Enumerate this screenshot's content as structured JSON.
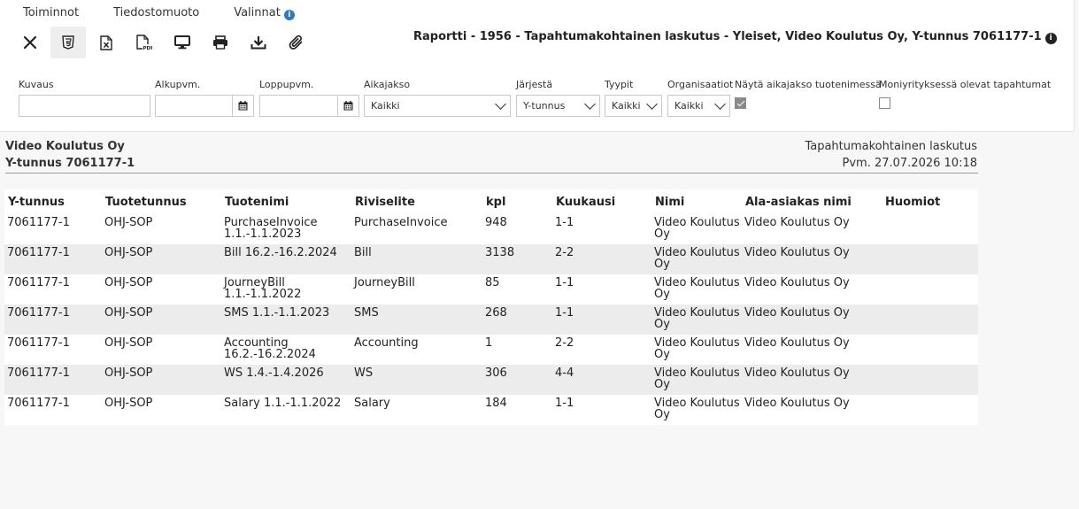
{
  "menu": {
    "actions": "Toiminnot",
    "file_format": "Tiedostomuoto",
    "options": "Valinnat",
    "info_glyph": "i"
  },
  "toolbar": {
    "icons": [
      "close-icon",
      "html5-icon",
      "excel-icon",
      "pdf-icon",
      "screen-icon",
      "print-icon",
      "download-icon",
      "attachment-icon"
    ]
  },
  "report_title": "Raportti - 1956 - Tapahtumakohtainen laskutus - Yleiset, Video Koulutus Oy, Y-tunnus 7061177-1",
  "filters": {
    "description": {
      "label": "Kuvaus",
      "value": ""
    },
    "start_date": {
      "label": "Alkupvm.",
      "value": ""
    },
    "end_date": {
      "label": "Loppupvm.",
      "value": ""
    },
    "period": {
      "label": "Aikajakso",
      "value": "Kaikki"
    },
    "sort": {
      "label": "Järjestä",
      "value": "Y-tunnus"
    },
    "types": {
      "label": "Tyypit",
      "value": "Kaikki"
    },
    "organisations": {
      "label": "Organisaatiot",
      "value": "Kaikki"
    },
    "show_period": {
      "label": "Näytä aikajakso tuotenimessä",
      "checked": true
    },
    "multi_company": {
      "label": "Moniyrityksessä olevat tapahtumat",
      "checked": false
    }
  },
  "company": {
    "name": "Video Koulutus Oy",
    "business_id": "Y-tunnus 7061177-1"
  },
  "meta": {
    "report_name": "Tapahtumakohtainen laskutus",
    "date": "Pvm. 27.07.2026 10:18"
  },
  "table": {
    "columns": [
      "Y-tunnus",
      "Tuotetunnus",
      "Tuotenimi",
      "Riviselite",
      "kpl",
      "Kuukausi",
      "Nimi",
      "Ala-asiakas nimi",
      "Huomiot"
    ],
    "rows": [
      [
        "7061177-1",
        "OHJ-SOP",
        "PurchaseInvoice 1.1.-1.1.2023",
        "PurchaseInvoice",
        "948",
        "1-1",
        "Video Koulutus Oy",
        "Video Koulutus Oy",
        ""
      ],
      [
        "7061177-1",
        "OHJ-SOP",
        "Bill 16.2.-16.2.2024",
        "Bill",
        "3138",
        "2-2",
        "Video Koulutus Oy",
        "Video Koulutus Oy",
        ""
      ],
      [
        "7061177-1",
        "OHJ-SOP",
        "JourneyBill 1.1.-1.1.2022",
        "JourneyBill",
        "85",
        "1-1",
        "Video Koulutus Oy",
        "Video Koulutus Oy",
        ""
      ],
      [
        "7061177-1",
        "OHJ-SOP",
        "SMS 1.1.-1.1.2023",
        "SMS",
        "268",
        "1-1",
        "Video Koulutus Oy",
        "Video Koulutus Oy",
        ""
      ],
      [
        "7061177-1",
        "OHJ-SOP",
        "Accounting 16.2.-16.2.2024",
        "Accounting",
        "1",
        "2-2",
        "Video Koulutus Oy",
        "Video Koulutus Oy",
        ""
      ],
      [
        "7061177-1",
        "OHJ-SOP",
        "WS 1.4.-1.4.2026",
        "WS",
        "306",
        "4-4",
        "Video Koulutus Oy",
        "Video Koulutus Oy",
        ""
      ],
      [
        "7061177-1",
        "OHJ-SOP",
        "Salary 1.1.-1.1.2022",
        "Salary",
        "184",
        "1-1",
        "Video Koulutus Oy",
        "Video Koulutus Oy",
        ""
      ]
    ]
  }
}
